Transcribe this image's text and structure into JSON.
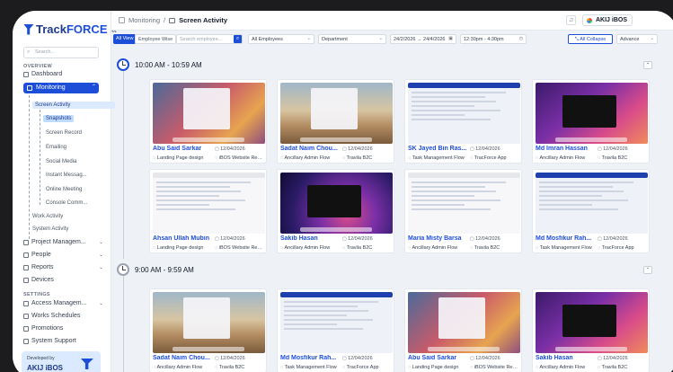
{
  "app": {
    "brand_a": "Track",
    "brand_b": "FORCE"
  },
  "sidebar": {
    "search_placeholder": "Search...",
    "overview_label": "OVERVIEW",
    "dashboard": "Dashboard",
    "monitoring": "Monitoring",
    "screen_activity": "Screen Activity",
    "snapshots": "Snapshots",
    "screen_record": "Screen Record",
    "emailing": "Emailing",
    "social_media": "Social Media",
    "instant_messaging": "Instant Messag...",
    "online_meeting": "Online Meeting",
    "console_commands": "Console Comm...",
    "work_activity": "Work Activity",
    "system_activity": "System Activity",
    "project_management": "Project Managem...",
    "people": "People",
    "reports": "Reports",
    "devices": "Devices",
    "settings_label": "SETTINGS",
    "access_management": "Access Managem...",
    "works_schedules": "Works Schedules",
    "promotions": "Promotions",
    "system_support": "System Support",
    "developed_by": "Developed by",
    "developer": "AKIJ iBOS"
  },
  "topbar": {
    "crumb_parent": "Monitoring",
    "crumb_sep": "/",
    "crumb_current": "Screen Activity",
    "org": "AKIJ iBOS"
  },
  "filters": {
    "all_view": "All View",
    "employee_wise": "Employee Wise",
    "search_placeholder": "Search employee...",
    "employees": "All Employees",
    "department": "Department",
    "date_range": "24/2/2026  →  24/4/2026",
    "time_range": "12:30pm  -  4:30pm",
    "all_collapse": "All Collapse",
    "advance": "Advance"
  },
  "slots": [
    {
      "time": "10:00 AM - 10:59 AM",
      "cards": [
        {
          "name": "Abu Said Sarkar",
          "date": "12/04/2026",
          "project": "Landing Page design",
          "app": "iBOS Website Redes...",
          "thumb": "mac"
        },
        {
          "name": "Sadat Naim Chou...",
          "date": "12/04/2026",
          "project": "Ancillary Admin  Flow",
          "app": "Travila B2C",
          "thumb": "desert"
        },
        {
          "name": "SK Jayed Bin Ras...",
          "date": "12/04/2026",
          "project": "Task Management Flow",
          "app": "TracForce App",
          "thumb": "web"
        },
        {
          "name": "Md Imran Hassan",
          "date": "12/04/2026",
          "project": "Ancillary Admin  Flow",
          "app": "Travila B2C",
          "thumb": "dark"
        },
        {
          "name": "Ahsan Ullah Mubin",
          "date": "12/04/2026",
          "project": "Landing Page design",
          "app": "iBOS Website Redes...",
          "thumb": "white"
        },
        {
          "name": "Sakib Hasan",
          "date": "12/04/2026",
          "project": "Ancillary Admin  Flow",
          "app": "Travila B2C",
          "thumb": "purple"
        },
        {
          "name": "Maria Misty Barsa",
          "date": "12/04/2026",
          "project": "Ancillary Admin  Flow",
          "app": "Travila B2C",
          "thumb": "white"
        },
        {
          "name": "Md Mosfikur Rah...",
          "date": "12/04/2026",
          "project": "Task Management Flow",
          "app": "TracForce App",
          "thumb": "web"
        }
      ]
    },
    {
      "time": "9:00 AM - 9:59 AM",
      "cards": [
        {
          "name": "Sadat Naim Chou...",
          "date": "12/04/2026",
          "project": "Ancillary Admin  Flow",
          "app": "Travila B2C",
          "thumb": "desert"
        },
        {
          "name": "Md Mosfikur Rah...",
          "date": "12/04/2026",
          "project": "Task Management Flow",
          "app": "TracForce App",
          "thumb": "web"
        },
        {
          "name": "Abu Said Sarkar",
          "date": "12/04/2026",
          "project": "Landing Page design",
          "app": "iBOS Website Redes...",
          "thumb": "mac"
        },
        {
          "name": "Sakib Hasan",
          "date": "12/04/2026",
          "project": "Ancillary Admin  Flow",
          "app": "Travila B2C",
          "thumb": "dark"
        }
      ]
    }
  ],
  "colors": {
    "primary": "#1d4ed8",
    "active_bg": "#dbeafe"
  }
}
